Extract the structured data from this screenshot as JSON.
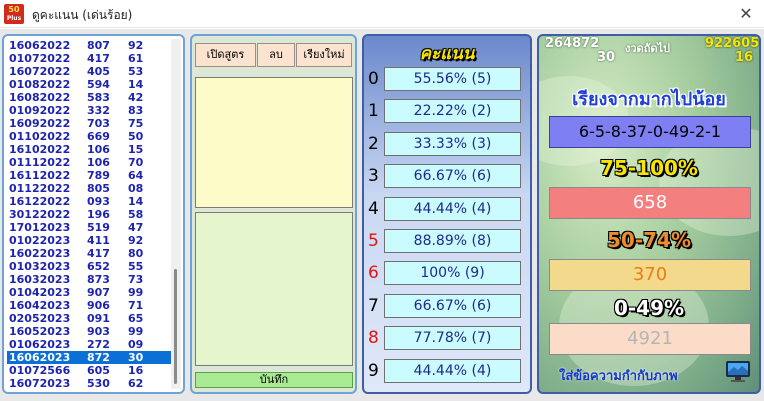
{
  "window": {
    "title": "ดูคะแนน (เด่นร้อย)",
    "icon_text_top": "50",
    "icon_text_bottom": "Plus",
    "close_glyph": "✕"
  },
  "list": {
    "rows": [
      {
        "date": "16062022",
        "a": "807",
        "b": "92"
      },
      {
        "date": "01072022",
        "a": "417",
        "b": "61"
      },
      {
        "date": "16072022",
        "a": "405",
        "b": "53"
      },
      {
        "date": "01082022",
        "a": "594",
        "b": "14"
      },
      {
        "date": "16082022",
        "a": "583",
        "b": "42"
      },
      {
        "date": "01092022",
        "a": "332",
        "b": "83"
      },
      {
        "date": "16092022",
        "a": "703",
        "b": "75"
      },
      {
        "date": "01102022",
        "a": "669",
        "b": "50"
      },
      {
        "date": "16102022",
        "a": "106",
        "b": "15"
      },
      {
        "date": "01112022",
        "a": "106",
        "b": "70"
      },
      {
        "date": "16112022",
        "a": "789",
        "b": "64"
      },
      {
        "date": "01122022",
        "a": "805",
        "b": "08"
      },
      {
        "date": "16122022",
        "a": "093",
        "b": "14"
      },
      {
        "date": "30122022",
        "a": "196",
        "b": "58"
      },
      {
        "date": "17012023",
        "a": "519",
        "b": "47"
      },
      {
        "date": "01022023",
        "a": "411",
        "b": "92"
      },
      {
        "date": "16022023",
        "a": "417",
        "b": "80"
      },
      {
        "date": "01032023",
        "a": "652",
        "b": "55"
      },
      {
        "date": "16032023",
        "a": "873",
        "b": "73"
      },
      {
        "date": "01042023",
        "a": "907",
        "b": "99"
      },
      {
        "date": "16042023",
        "a": "906",
        "b": "71"
      },
      {
        "date": "02052023",
        "a": "091",
        "b": "65"
      },
      {
        "date": "16052023",
        "a": "903",
        "b": "99"
      },
      {
        "date": "01062023",
        "a": "272",
        "b": "09"
      },
      {
        "date": "16062023",
        "a": "872",
        "b": "30",
        "selected": true
      },
      {
        "date": "01072566",
        "a": "605",
        "b": "16"
      },
      {
        "date": "16072023",
        "a": "530",
        "b": "62"
      }
    ]
  },
  "formula": {
    "open_label": "เปิดสูตร",
    "delete_label": "ลบ",
    "sort_label": "เรียงใหม่",
    "save_label": "บันทึก"
  },
  "score": {
    "header": "คะแนน",
    "rows": [
      {
        "digit": "0",
        "value": "55.56% (5)",
        "red": false
      },
      {
        "digit": "1",
        "value": "22.22% (2)",
        "red": false
      },
      {
        "digit": "2",
        "value": "33.33% (3)",
        "red": false
      },
      {
        "digit": "3",
        "value": "66.67% (6)",
        "red": false
      },
      {
        "digit": "4",
        "value": "44.44% (4)",
        "red": false
      },
      {
        "digit": "5",
        "value": "88.89% (8)",
        "red": true
      },
      {
        "digit": "6",
        "value": "100% (9)",
        "red": true
      },
      {
        "digit": "7",
        "value": "66.67% (6)",
        "red": false
      },
      {
        "digit": "8",
        "value": "77.78% (7)",
        "red": true
      },
      {
        "digit": "9",
        "value": "44.44% (4)",
        "red": false
      }
    ]
  },
  "summary": {
    "current_top": "264872",
    "current_bottom": "30",
    "next_label": "งวดถัดไป",
    "next_top": "922605",
    "next_bottom": "16",
    "sort_title": "เรียงจากมากไปน้อย",
    "sequence": "6-5-8-37-0-49-2-1",
    "range_high_label": "75-100%",
    "range_high_value": "658",
    "range_mid_label": "50-74%",
    "range_mid_value": "370",
    "range_low_label": "0-49%",
    "range_low_value": "4921",
    "bottom_link": "ใส่ข้อความกำกับภาพ"
  },
  "colors": {
    "list_text": "#1e23b0",
    "selected_row": "#0a70d6",
    "score_box": "#c9fbff",
    "sequence_box": "#7d7ff2",
    "range_high_box": "#f37f7f",
    "range_mid_box": "#f2d98c",
    "range_low_box": "#fbdcc8"
  },
  "icons": {
    "close": "close-icon",
    "monitor": "monitor-icon",
    "app": "app-logo-icon"
  }
}
